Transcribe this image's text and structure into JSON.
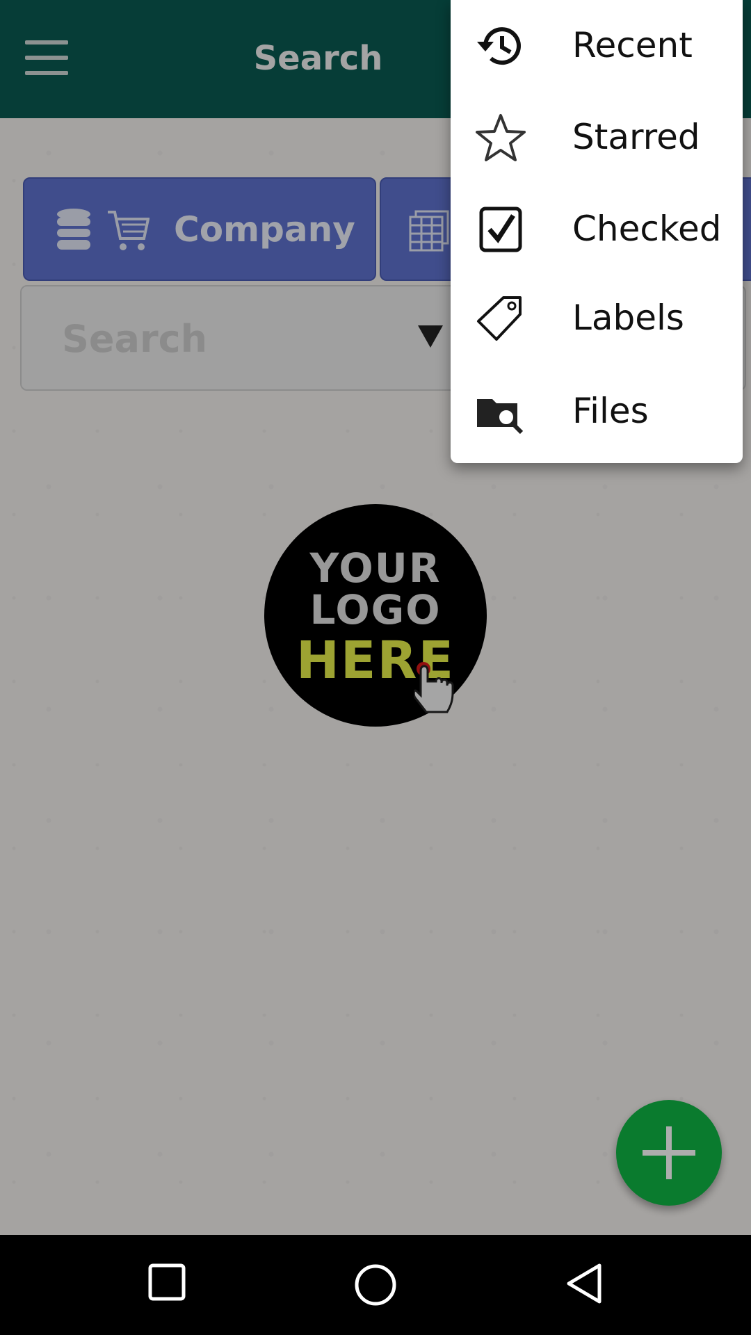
{
  "appbar": {
    "title": "Search"
  },
  "tiles": [
    {
      "label": "Company"
    },
    {
      "label": ""
    }
  ],
  "search": {
    "placeholder": "Search"
  },
  "logo": {
    "line1": "YOUR",
    "line2": "LOGO",
    "line3": "HERE"
  },
  "menu": {
    "items": [
      {
        "label": "Recent",
        "icon": "history-icon"
      },
      {
        "label": "Starred",
        "icon": "star-icon"
      },
      {
        "label": "Checked",
        "icon": "checkbox-icon"
      },
      {
        "label": "Labels",
        "icon": "tag-icon"
      },
      {
        "label": "Files",
        "icon": "folder-search-icon"
      }
    ]
  },
  "colors": {
    "appbar": "#0a5b52",
    "tile": "#5f72cf",
    "fab": "#0fb544"
  }
}
